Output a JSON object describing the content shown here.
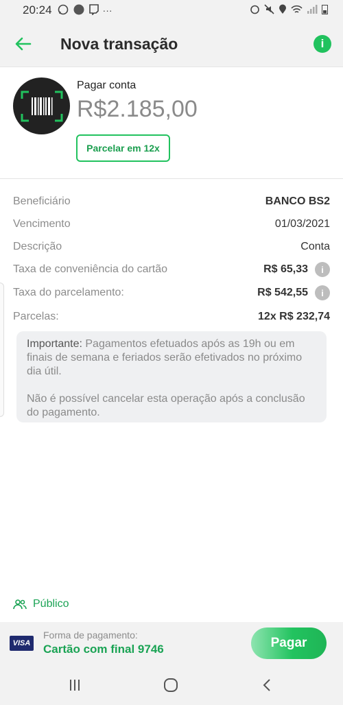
{
  "status_bar": {
    "time": "20:24",
    "more": "···"
  },
  "app_bar": {
    "title": "Nova transação",
    "info": "i"
  },
  "summary": {
    "label": "Pagar conta",
    "amount": "R$2.185,00",
    "installment_button": "Parcelar em 12x"
  },
  "details": [
    {
      "key": "Beneficiário",
      "value": "BANCO BS2"
    },
    {
      "key": "Vencimento",
      "value": "01/03/2021"
    },
    {
      "key": "Descrição",
      "value": "Conta"
    },
    {
      "key": "Taxa de conveniência do cartão",
      "value": "R$ 65,33"
    },
    {
      "key": "Taxa do parcelamento:",
      "value": "R$ 542,55"
    },
    {
      "key": "Parcelas:",
      "value": "12x R$ 232,74"
    }
  ],
  "notice": {
    "bold_prefix": "Importante:",
    "line1": " Pagamentos efetuados após as 19h ou em finais de semana e feriados serão efetivados no próximo dia útil.",
    "line2": "Não é possível cancelar esta operação após a conclusão do pagamento."
  },
  "privacy": {
    "label": "Público"
  },
  "payment": {
    "brand": "VISA",
    "method_label": "Forma de pagamento:",
    "card": "Cartão com final 9746",
    "pay_button": "Pagar"
  },
  "colors": {
    "accent": "#21c25e",
    "accent_dark": "#1aa354",
    "background": "#f2f2f2"
  }
}
